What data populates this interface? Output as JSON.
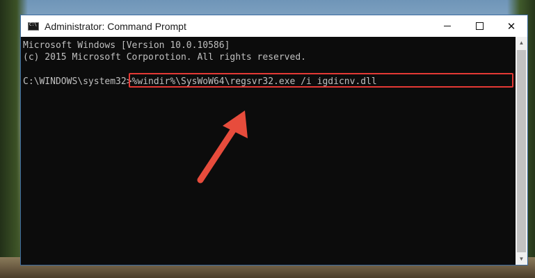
{
  "window": {
    "title": "Administrator: Command Prompt",
    "icon": "cmd-icon"
  },
  "console": {
    "lines": [
      "Microsoft Windows [Version 10.0.10586]",
      "(c) 2015 Microsoft Corporotion. All rights reserved."
    ],
    "prompt": "C:\\WINDOWS\\system32>",
    "command": "%windir%\\SysWoW64\\regsvr32.exe /i igdicnv.dll"
  },
  "colors": {
    "highlight": "#e53935",
    "arrow": "#e74c3c"
  }
}
